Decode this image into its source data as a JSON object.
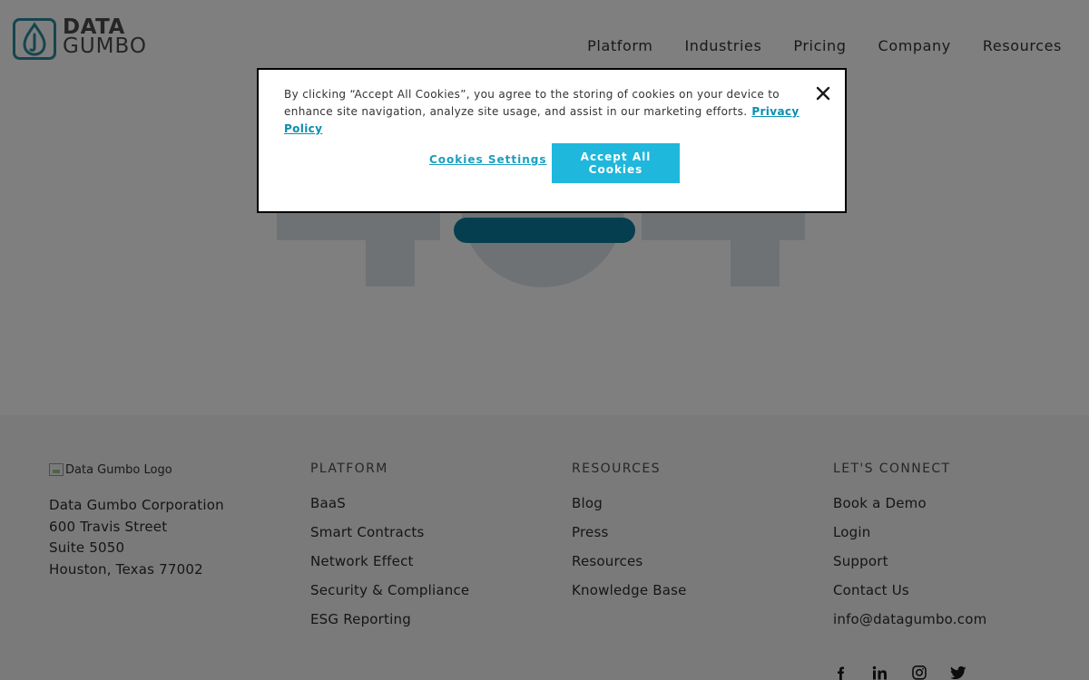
{
  "brand": {
    "line1": "DATA",
    "line2": "GUMBO",
    "color": "#2d8b9e"
  },
  "nav": {
    "items": [
      {
        "label": "Platform"
      },
      {
        "label": "Industries"
      },
      {
        "label": "Pricing"
      },
      {
        "label": "Company"
      },
      {
        "label": "Resources"
      }
    ]
  },
  "footer": {
    "logo_alt": "Data Gumbo Logo",
    "address": [
      "Data Gumbo Corporation",
      "600 Travis Street",
      "Suite 5050",
      "Houston, Texas 77002"
    ],
    "columns": [
      {
        "heading": "PLATFORM",
        "links": [
          "BaaS",
          "Smart Contracts",
          "Network Effect",
          "Security & Compliance",
          "ESG Reporting"
        ]
      },
      {
        "heading": "RESOURCES",
        "links": [
          "Blog",
          "Press",
          "Resources",
          "Knowledge Base"
        ]
      },
      {
        "heading": "LET'S CONNECT",
        "links": [
          "Book a Demo",
          "Login",
          "Support",
          "Contact Us",
          "info@datagumbo.com"
        ]
      }
    ],
    "social_icons": [
      "facebook-icon",
      "linkedin-icon",
      "instagram-icon",
      "twitter-icon"
    ]
  },
  "cookie_banner": {
    "text": "By clicking “Accept All Cookies”, you agree to the storing of cookies on your device to enhance site navigation, analyze site usage, and assist in our marketing efforts.",
    "privacy_link": "Privacy Policy",
    "settings_label": "Cookies Settings",
    "accept_label": "Accept All Cookies",
    "accent_color": "#1fb7dc"
  },
  "colors": {
    "overlay": "rgba(0,0,0,0.5)",
    "hero_button": "#0a7e9e"
  }
}
